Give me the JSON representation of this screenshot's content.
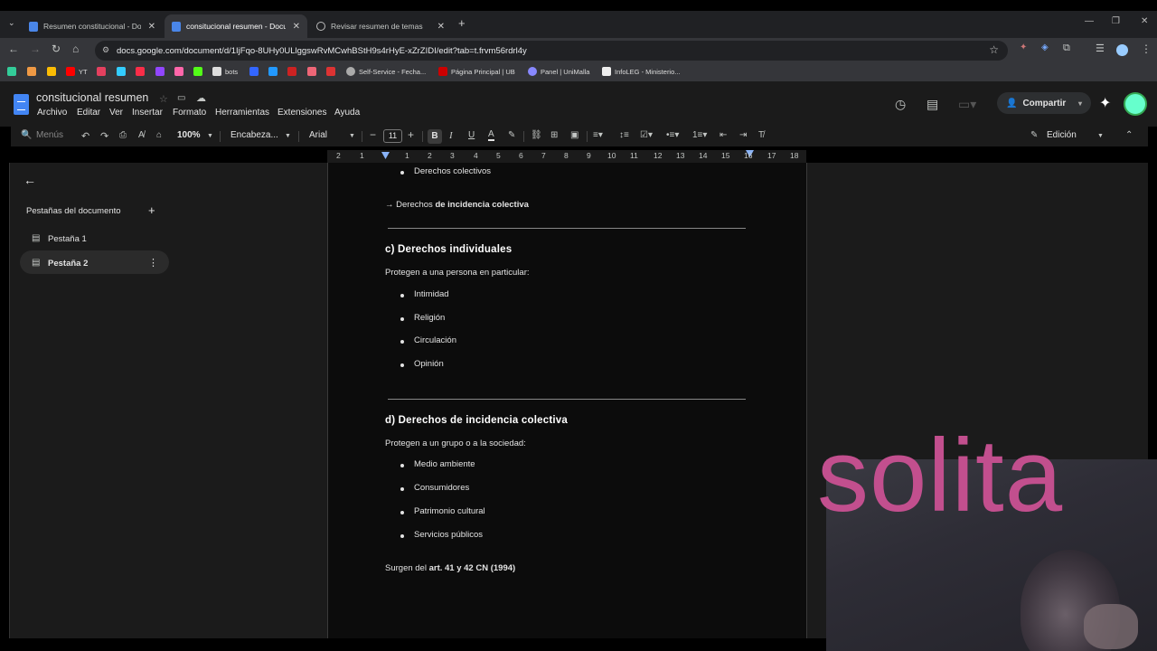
{
  "browser": {
    "tabs": [
      {
        "title": "Resumen constitucional - Docu",
        "active": false
      },
      {
        "title": "consitucional resumen - Docum",
        "active": true
      },
      {
        "title": "Revisar resumen de temas",
        "active": false
      }
    ],
    "url": "docs.google.com/document/d/1IjFqo-8UHy0ULlggswRvMCwhBStH9s4rHyE-xZrZIDI/edit?tab=t.frvm56rdrl4y",
    "bookmarks": [
      "YT",
      "bots",
      "Self-Service - Fecha...",
      "Página Principal | UB",
      "Panel | UniMalla",
      "InfoLEG - Ministerio..."
    ]
  },
  "docs": {
    "title": "consitucional resumen",
    "menu": [
      "Archivo",
      "Editar",
      "Ver",
      "Insertar",
      "Formato",
      "Herramientas",
      "Extensiones",
      "Ayuda"
    ],
    "share_label": "Compartir",
    "toolbar": {
      "search_placeholder": "Menús",
      "zoom": "100%",
      "style": "Encabeza...",
      "font": "Arial",
      "font_size": "11",
      "mode": "Edición"
    },
    "ruler_labels": [
      "2",
      "1",
      "1",
      "2",
      "3",
      "4",
      "5",
      "6",
      "7",
      "8",
      "9",
      "10",
      "11",
      "12",
      "13",
      "14",
      "15",
      "16",
      "17",
      "18"
    ]
  },
  "sidebar": {
    "heading": "Pestañas del documento",
    "tabs": [
      "Pestaña 1",
      "Pestaña 2"
    ]
  },
  "document": {
    "top_bullet": "Derechos colectivos",
    "arrow_line_prefix": "→ Derechos ",
    "arrow_line_bold": "de incidencia colectiva",
    "section_c": {
      "heading": "c) Derechos individuales",
      "intro": "Protegen a una persona en particular:",
      "items": [
        "Intimidad",
        "Religión",
        "Circulación",
        "Opinión"
      ]
    },
    "section_d": {
      "heading": "d) Derechos de incidencia colectiva",
      "intro": "Protegen a un grupo o a la sociedad:",
      "items": [
        "Medio ambiente",
        "Consumidores",
        "Patrimonio cultural",
        "Servicios públicos"
      ]
    },
    "footer_prefix": "Surgen del ",
    "footer_bold": "art. 41 y 42 CN (1994)"
  },
  "overlay": {
    "text": "solita",
    "color": "#c24f8e"
  }
}
